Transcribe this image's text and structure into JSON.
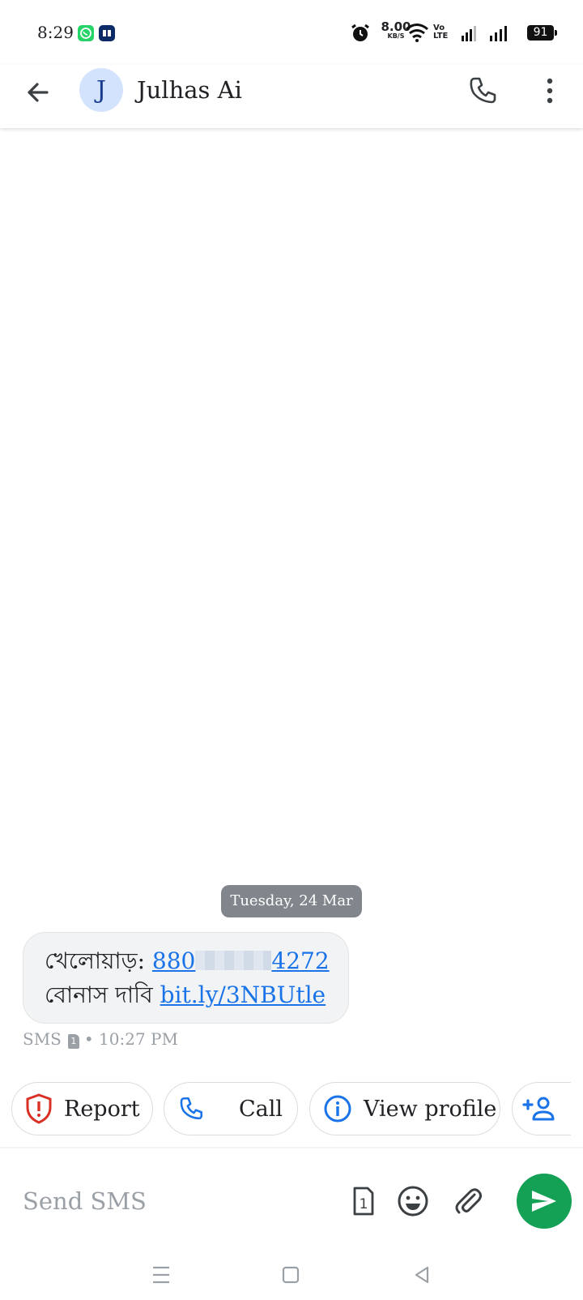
{
  "status_bar": {
    "time": "8:29",
    "net_speed_value": "8.00",
    "net_speed_unit": "KB/S",
    "volte_label": "Vo LTE",
    "battery": "91"
  },
  "header": {
    "avatar_letter": "J",
    "contact_name": "Julhas Ai"
  },
  "conversation": {
    "date_divider": "Tuesday, 24 Mar",
    "message": {
      "line1_text": "খেলোয়াড়: ",
      "phone_prefix": "880",
      "phone_suffix": "4272",
      "line2_text": "বোনাস দাবি ",
      "link": "bit.ly/3NBUtle"
    },
    "meta": {
      "type": "SMS",
      "sim": "1",
      "separator": "•",
      "time": "10:27 PM"
    }
  },
  "suggestions": [
    {
      "label": "Report",
      "icon": "shield-alert-icon"
    },
    {
      "label": "Call",
      "icon": "phone-icon"
    },
    {
      "label": "View profile",
      "icon": "info-icon"
    },
    {
      "label": "",
      "icon": "add-person-icon"
    }
  ],
  "compose": {
    "placeholder": "Send SMS",
    "sim_label": "1"
  },
  "colors": {
    "accent": "#1a73e8",
    "send_button": "#14a155",
    "report_red": "#d93025",
    "avatar_bg": "#d3e3fd"
  }
}
